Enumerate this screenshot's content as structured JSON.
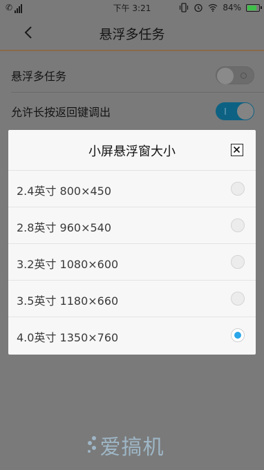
{
  "status_bar": {
    "carrier_icon": "call-signal-icon",
    "time": "下午 3:21",
    "battery_percent": "84%",
    "battery_level": 0.84,
    "icons": [
      "vibrate-icon",
      "alarm-icon",
      "wifi-icon",
      "battery-icon"
    ]
  },
  "header": {
    "title": "悬浮多任务",
    "back_icon": "chevron-left-icon"
  },
  "settings": {
    "items": [
      {
        "label": "悬浮多任务",
        "toggle_on": false
      },
      {
        "label": "允许长按返回键调出",
        "toggle_on": true
      }
    ]
  },
  "dialog": {
    "title": "小屏悬浮窗大小",
    "close_icon": "close-icon",
    "options": [
      {
        "label": "2.4英寸 800×450",
        "selected": false
      },
      {
        "label": "2.8英寸 960×540",
        "selected": false
      },
      {
        "label": "3.2英寸 1080×600",
        "selected": false
      },
      {
        "label": "3.5英寸 1180×660",
        "selected": false
      },
      {
        "label": "4.0英寸 1350×760",
        "selected": true
      }
    ]
  },
  "colors": {
    "accent": "#2aa6e8",
    "toggle_on": "#0d6283",
    "battery": "#3fbf4a"
  },
  "watermark": "爱搞机"
}
